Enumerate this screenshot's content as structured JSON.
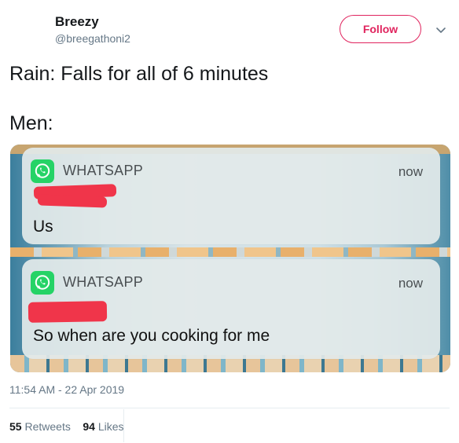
{
  "tweet": {
    "author_name": "Breezy",
    "author_handle": "@breegathoni2",
    "follow_label": "Follow",
    "line1": "Rain: Falls for all of 6 minutes",
    "line2": "Men:",
    "timestamp": "11:54 AM - 22 Apr 2019",
    "retweets_count": "55",
    "retweets_label": "Retweets",
    "likes_count": "94",
    "likes_label": "Likes"
  },
  "notifications": [
    {
      "app": "WHATSAPP",
      "time": "now",
      "message": "Us"
    },
    {
      "app": "WHATSAPP",
      "time": "now",
      "message": "So when are you cooking for me"
    }
  ],
  "colors": {
    "follow": "#e0245e",
    "whatsapp": "#25d366",
    "redaction": "#f0354a"
  },
  "icons": {
    "dropdown": "chevron-down-icon",
    "app": "whatsapp-icon"
  }
}
